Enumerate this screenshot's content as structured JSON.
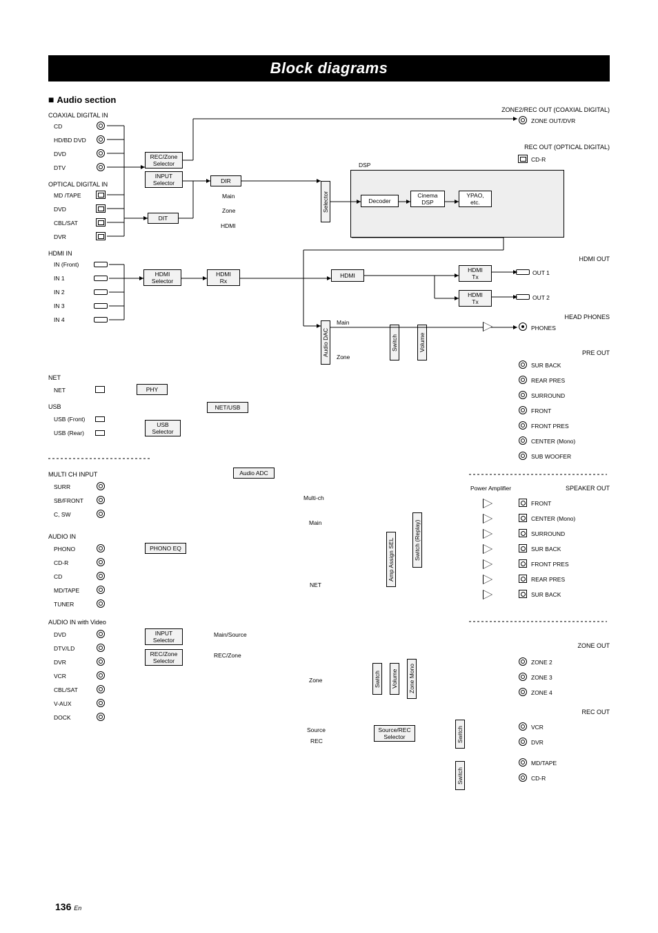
{
  "page_title": "Block diagrams",
  "section_title": "Audio section",
  "page_number": "136",
  "page_lang": "En",
  "inputs": {
    "coax_header": "COAXIAL DIGITAL IN",
    "coax": [
      "CD",
      "HD/BD DVD",
      "DVD",
      "DTV"
    ],
    "optical_header": "OPTICAL DIGITAL IN",
    "optical": [
      "MD /TAPE",
      "DVD",
      "CBL/SAT",
      "DVR"
    ],
    "hdmi_header": "HDMI IN",
    "hdmi": [
      "IN (Front)",
      "IN 1",
      "IN 2",
      "IN 3",
      "IN 4"
    ],
    "net_header": "NET",
    "net": [
      "NET"
    ],
    "usb_header": "USB",
    "usb": [
      "USB (Front)",
      "USB (Rear)"
    ],
    "multich_header": "MULTI CH INPUT",
    "multich": [
      "SURR",
      "SB/FRONT",
      "C, SW"
    ],
    "audioin_header": "AUDIO IN",
    "audioin": [
      "PHONO",
      "CD-R",
      "CD",
      "MD/TAPE",
      "TUNER"
    ],
    "audioin_video_header": "AUDIO IN with Video",
    "audioin_video": [
      "DVD",
      "DTV/LD",
      "DVR",
      "VCR",
      "CBL/SAT",
      "V-AUX",
      "DOCK"
    ]
  },
  "blocks": {
    "rec_zone_sel_1": "REC/Zone\nSelector",
    "input_sel_1": "INPUT\nSelector",
    "dit": "DIT",
    "dir": "DIR",
    "decoder": "Decoder",
    "cinema_dsp": "Cinema\nDSP",
    "ypao": "YPAO,\netc.",
    "dsp_label": "DSP",
    "hdmi_sel": "HDMI\nSelector",
    "hdmi_rx": "HDMI\nRx",
    "hdmi_label": "HDMI",
    "hdmi_tx_1": "HDMI\nTx",
    "hdmi_tx_2": "HDMI\nTx",
    "phy": "PHY",
    "usb_sel": "USB\nSelector",
    "netusb": "NET/USB",
    "audio_adc": "Audio ADC",
    "phono_eq": "PHONO EQ",
    "input_sel_2": "INPUT\nSelector",
    "rec_zone_sel_2": "REC/Zone\nSelector",
    "source_rec_sel": "Source/REC\nSelector",
    "selector_v": "Selector",
    "audio_dac_v": "Audio DAC",
    "switch_1": "Switch",
    "volume_1": "Volume",
    "amp_assign": "Amp Assign SEL",
    "switch_replay": "Switch (Replay)",
    "switch_2": "Switch",
    "volume_2": "Volume",
    "zone_mono": "Zone Mono",
    "switch_3": "Switch",
    "switch_4": "Switch",
    "power_amp": "Power Amplifier"
  },
  "signals": {
    "main": "Main",
    "zone": "Zone",
    "hdmi": "HDMI",
    "multich": "Multi-ch",
    "net": "NET",
    "main_source": "Main/Source",
    "rec_zone": "REC/Zone",
    "source": "Source",
    "rec": "REC",
    "zone_lbl": "Zone"
  },
  "outputs": {
    "zone2_rec_header": "ZONE2/REC OUT (COAXIAL DIGITAL)",
    "zone_out_dvr": "ZONE OUT/DVR",
    "rec_out_opt_header": "REC OUT (OPTICAL DIGITAL)",
    "cdr": "CD-R",
    "hdmi_out_header": "HDMI OUT",
    "out1": "OUT 1",
    "out2": "OUT 2",
    "headphones_header": "HEAD PHONES",
    "phones": "PHONES",
    "preout_header": "PRE OUT",
    "preout": [
      "SUR BACK",
      "REAR PRES",
      "SURROUND",
      "FRONT",
      "FRONT PRES",
      "CENTER (Mono)",
      "SUB WOOFER"
    ],
    "speaker_header": "SPEAKER OUT",
    "speakers": [
      "FRONT",
      "CENTER (Mono)",
      "SURROUND",
      "SUR BACK",
      "FRONT PRES",
      "REAR PRES",
      "SUR BACK"
    ],
    "zoneout_header": "ZONE OUT",
    "zoneout": [
      "ZONE 2",
      "ZONE 3",
      "ZONE 4"
    ],
    "recout_header": "REC OUT",
    "recout": [
      "VCR",
      "DVR",
      "MD/TAPE",
      "CD-R"
    ]
  },
  "chart_data": {
    "type": "block-diagram",
    "description": "Audio section signal flow block diagram for an AV receiver",
    "input_groups": [
      {
        "name": "COAXIAL DIGITAL IN",
        "items": [
          "CD",
          "HD/BD DVD",
          "DVD",
          "DTV"
        ]
      },
      {
        "name": "OPTICAL DIGITAL IN",
        "items": [
          "MD /TAPE",
          "DVD",
          "CBL/SAT",
          "DVR"
        ]
      },
      {
        "name": "HDMI IN",
        "items": [
          "IN (Front)",
          "IN 1",
          "IN 2",
          "IN 3",
          "IN 4"
        ]
      },
      {
        "name": "NET",
        "items": [
          "NET"
        ]
      },
      {
        "name": "USB",
        "items": [
          "USB (Front)",
          "USB (Rear)"
        ]
      },
      {
        "name": "MULTI CH INPUT",
        "items": [
          "SURR",
          "SB/FRONT",
          "C, SW"
        ]
      },
      {
        "name": "AUDIO IN",
        "items": [
          "PHONO",
          "CD-R",
          "CD",
          "MD/TAPE",
          "TUNER"
        ]
      },
      {
        "name": "AUDIO IN with Video",
        "items": [
          "DVD",
          "DTV/LD",
          "DVR",
          "VCR",
          "CBL/SAT",
          "V-AUX",
          "DOCK"
        ]
      }
    ],
    "processing_blocks": [
      "REC/Zone Selector",
      "INPUT Selector",
      "DIT",
      "DIR",
      "Selector",
      "Decoder",
      "Cinema DSP",
      "YPAO, etc.",
      "HDMI Selector",
      "HDMI Rx",
      "HDMI",
      "HDMI Tx",
      "PHY",
      "USB Selector",
      "NET/USB",
      "Audio DAC",
      "Switch",
      "Volume",
      "Audio ADC",
      "PHONO EQ",
      "Amp Assign SEL",
      "Switch (Replay)",
      "Zone Mono",
      "Source/REC Selector",
      "Power Amplifier"
    ],
    "output_groups": [
      {
        "name": "ZONE2/REC OUT (COAXIAL DIGITAL)",
        "items": [
          "ZONE OUT/DVR"
        ]
      },
      {
        "name": "REC OUT (OPTICAL DIGITAL)",
        "items": [
          "CD-R"
        ]
      },
      {
        "name": "HDMI OUT",
        "items": [
          "OUT 1",
          "OUT 2"
        ]
      },
      {
        "name": "HEAD PHONES",
        "items": [
          "PHONES"
        ]
      },
      {
        "name": "PRE OUT",
        "items": [
          "SUR BACK",
          "REAR PRES",
          "SURROUND",
          "FRONT",
          "FRONT PRES",
          "CENTER (Mono)",
          "SUB WOOFER"
        ]
      },
      {
        "name": "SPEAKER OUT",
        "items": [
          "FRONT",
          "CENTER (Mono)",
          "SURROUND",
          "SUR BACK",
          "FRONT PRES",
          "REAR PRES",
          "SUR BACK"
        ]
      },
      {
        "name": "ZONE OUT",
        "items": [
          "ZONE 2",
          "ZONE 3",
          "ZONE 4"
        ]
      },
      {
        "name": "REC OUT",
        "items": [
          "VCR",
          "DVR",
          "MD/TAPE",
          "CD-R"
        ]
      }
    ]
  }
}
